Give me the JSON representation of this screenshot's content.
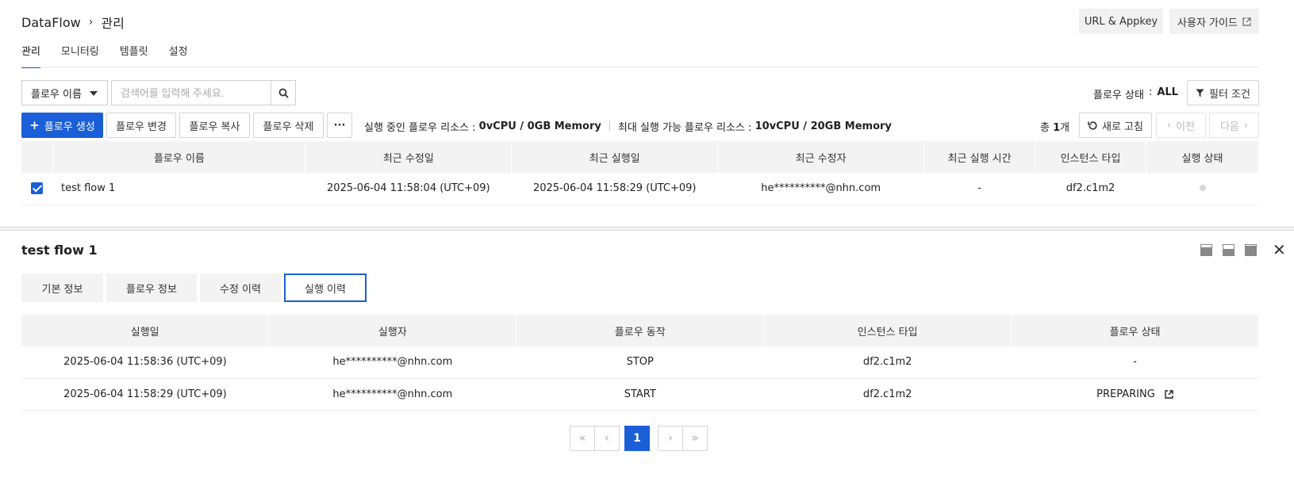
{
  "header": {
    "app": "DataFlow",
    "section": "관리",
    "url_appkey_label": "URL & Appkey",
    "user_guide_label": "사용자 가이드"
  },
  "tabs": [
    {
      "label": "관리"
    },
    {
      "label": "모니터링"
    },
    {
      "label": "템플릿"
    },
    {
      "label": "설정"
    }
  ],
  "search": {
    "field_label": "플로우 이름",
    "placeholder": "검색어를 입력해 주세요.",
    "status_label": "플로우 상태",
    "status_colon": ":",
    "status_value": "ALL",
    "filter_label": "필터 조건"
  },
  "actions": {
    "create": "플로우 생성",
    "edit": "플로우 변경",
    "copy": "플로우 복사",
    "delete": "플로우 삭제",
    "more": "···",
    "running_label": "실행 중인 플로우 리소스 :",
    "running_value": "0vCPU / 0GB Memory",
    "max_label": "최대 실행 가능 플로우 리소스 :",
    "max_value": "10vCPU / 20GB Memory",
    "total_prefix": "총",
    "total_count": "1",
    "total_suffix": "개",
    "refresh": "새로 고침",
    "prev": "이전",
    "next": "다음"
  },
  "flow_table": {
    "headers": [
      "플로우 이름",
      "최근 수정일",
      "최근 실행일",
      "최근 수정자",
      "최근 실행 시간",
      "인스턴스 타입",
      "실행 상태"
    ],
    "rows": [
      {
        "name": "test flow 1",
        "modified": "2025-06-04 11:58:04 (UTC+09)",
        "executed": "2025-06-04 11:58:29 (UTC+09)",
        "modifier": "he**********@nhn.com",
        "exec_time": "-",
        "instance": "df2.c1m2"
      }
    ]
  },
  "detail": {
    "title": "test flow 1",
    "tabs": [
      {
        "label": "기본 정보"
      },
      {
        "label": "플로우 정보"
      },
      {
        "label": "수정 이력"
      },
      {
        "label": "실행 이력"
      }
    ],
    "history_headers": [
      "실행일",
      "실행자",
      "플로우 동작",
      "인스턴스 타입",
      "플로우 상태"
    ],
    "history_rows": [
      {
        "date": "2025-06-04 11:58:36 (UTC+09)",
        "user": "he**********@nhn.com",
        "action": "STOP",
        "instance": "df2.c1m2",
        "status": "-"
      },
      {
        "date": "2025-06-04 11:58:29 (UTC+09)",
        "user": "he**********@nhn.com",
        "action": "START",
        "instance": "df2.c1m2",
        "status": "PREPARING"
      }
    ],
    "page": "1"
  }
}
